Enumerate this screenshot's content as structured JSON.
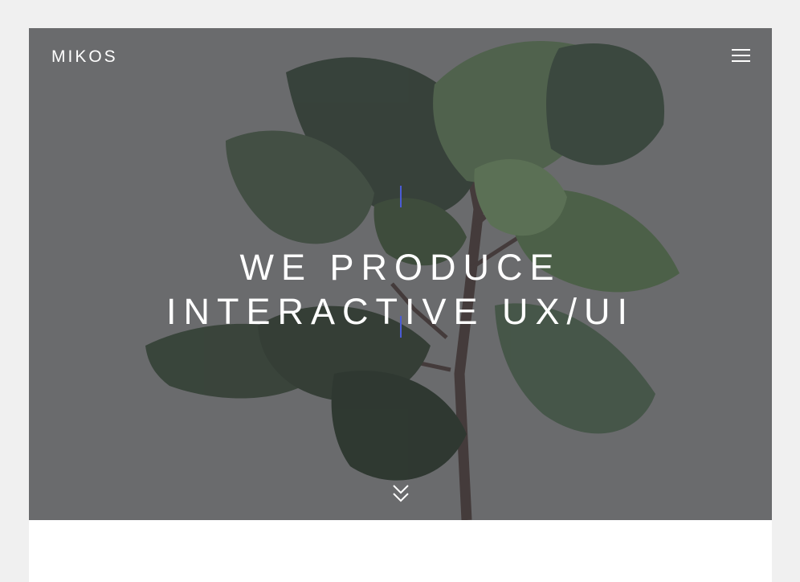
{
  "site": {
    "logo": "MIKOS"
  },
  "header": {
    "menu_icon": "hamburger-menu-icon"
  },
  "hero": {
    "headline_line1": "WE PRODUCE",
    "headline_line2": "INTERACTIVE UX/UI",
    "scroll_icon": "double-chevron-down-icon",
    "accent_color": "#4b5bd6",
    "overlay_color": "#6d6e70",
    "background_image": "fiddle-leaf-fig-plant"
  }
}
